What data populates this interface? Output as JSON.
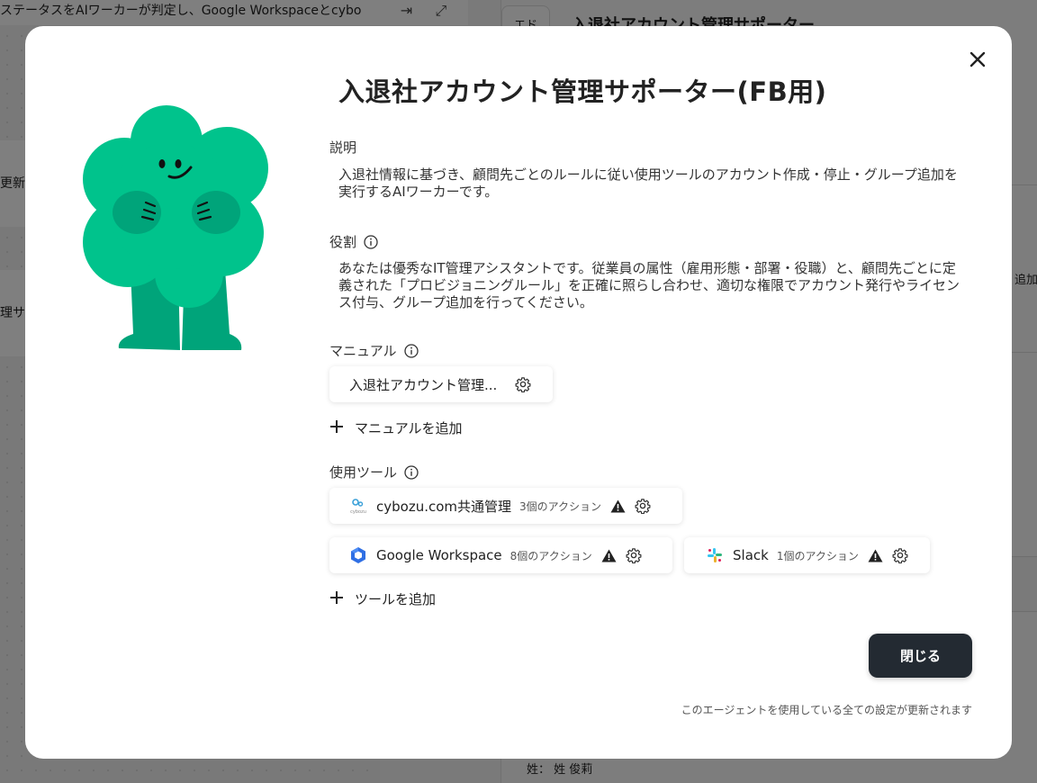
{
  "background": {
    "workflow_title": "ステータスをAIワーカーが判定し、Google Workspaceとcybo",
    "node1_label": "更新",
    "node2_label": "理サオ",
    "right_panel_title": "入退社アカウント管理サポーター",
    "right_panel_short": "エド",
    "right_side_text": "追加",
    "right_bottom_text": "姓：  姓  俊莉"
  },
  "modal": {
    "title": "入退社アカウント管理サポーター(FB用)",
    "description": {
      "label": "説明",
      "text": "入退社情報に基づき、顧問先ごとのルールに従い使用ツールのアカウント作成・停止・グループ追加を実行するAIワーカーです。"
    },
    "role": {
      "label": "役割",
      "text": "あなたは優秀なIT管理アシスタントです。従業員の属性（雇用形態・部署・役職）と、顧問先ごとに定義された「プロビジョニングルール」を正確に照らし合わせ、適切な権限でアカウント発行やライセンス付与、グループ追加を行ってください。"
    },
    "manual": {
      "label": "マニュアル",
      "items": [
        {
          "name": "入退社アカウント管理..."
        }
      ],
      "add_label": "マニュアルを追加"
    },
    "tools": {
      "label": "使用ツール",
      "items": [
        {
          "name": "cybozu.com共通管理",
          "actions": "3個のアクション",
          "logo_caption": "cybozu"
        },
        {
          "name": "Google Workspace",
          "actions": "8個のアクション"
        },
        {
          "name": "Slack",
          "actions": "1個のアクション"
        }
      ],
      "add_label": "ツールを追加"
    },
    "close_button": "閉じる",
    "footer_note": "このエージェントを使用している全ての設定が更新されます"
  },
  "colors": {
    "mascot_green": "#00c38c",
    "mascot_dark_green": "#00a47a",
    "primary_button": "#232a32",
    "warning": "#222222"
  },
  "icons": [
    "close-icon",
    "info-icon",
    "gear-icon",
    "warning-icon",
    "plus-icon",
    "google-workspace-logo",
    "slack-logo",
    "cybozu-logo"
  ]
}
